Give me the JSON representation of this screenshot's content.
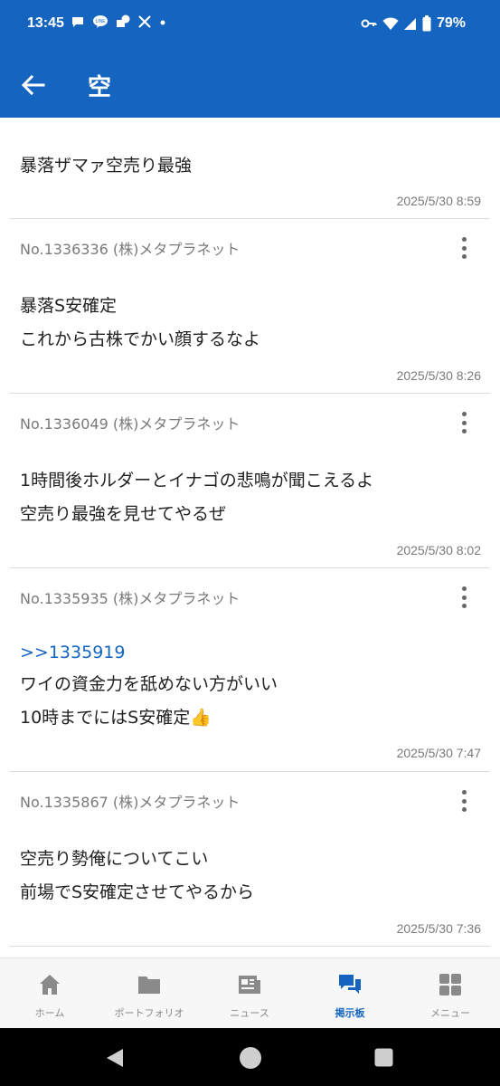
{
  "status_bar": {
    "time": "13:45",
    "battery": "79%",
    "notification_icons": [
      "chat-bubble-icon",
      "line-icon",
      "messenger-icon",
      "x-icon",
      "dot-icon"
    ],
    "system_icons": [
      "key-icon",
      "wifi-icon",
      "signal-icon",
      "battery-icon"
    ]
  },
  "app_bar": {
    "title": "空"
  },
  "posts": [
    {
      "meta": "",
      "lines": [
        "暴落ザマァ空売り最強"
      ],
      "time": "2025/5/30 8:59"
    },
    {
      "meta": "No.1336336 (株)メタプラネット",
      "lines": [
        "暴落S安確定",
        "これから古株でかい顔するなよ"
      ],
      "time": "2025/5/30 8:26"
    },
    {
      "meta": "No.1336049 (株)メタプラネット",
      "lines": [
        "1時間後ホルダーとイナゴの悲鳴が聞こえるよ",
        "空売り最強を見せてやるぜ"
      ],
      "time": "2025/5/30 8:02"
    },
    {
      "meta": "No.1335935 (株)メタプラネット",
      "reply": ">>1335919",
      "lines": [
        "ワイの資金力を舐めない方がいい",
        "10時までにはS安確定👍"
      ],
      "time": "2025/5/30 7:47"
    },
    {
      "meta": "No.1335867 (株)メタプラネット",
      "lines": [
        "空売り勢俺についてこい",
        "前場でS安確定させてやるから"
      ],
      "time": "2025/5/30 7:36"
    }
  ],
  "bottom_nav": {
    "active": "掲示板",
    "items": [
      {
        "label": "ホーム",
        "icon": "home-icon"
      },
      {
        "label": "ポートフォリオ",
        "icon": "folder-icon"
      },
      {
        "label": "ニュース",
        "icon": "news-icon"
      },
      {
        "label": "掲示板",
        "icon": "chat-icon"
      },
      {
        "label": "メニュー",
        "icon": "grid-icon"
      }
    ]
  },
  "colors": {
    "brand": "#1565c0",
    "meta_text": "#7a7a7a",
    "divider": "#dcdcdc",
    "link": "#1565c0"
  }
}
